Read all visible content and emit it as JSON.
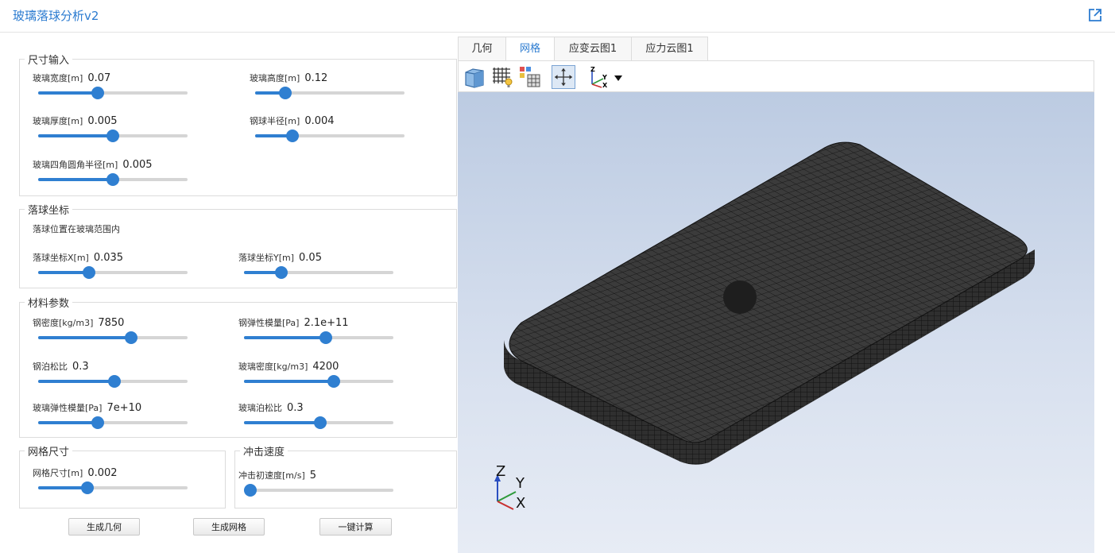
{
  "app": {
    "title": "玻璃落球分析v2",
    "popout_icon": "external-link-icon",
    "accent": "#2b7bd0"
  },
  "size_input": {
    "legend": "尺寸输入",
    "glass_width": {
      "label": "玻璃宽度[m]",
      "value": "0.07",
      "level": 0.4
    },
    "glass_height": {
      "label": "玻璃高度[m]",
      "value": "0.12",
      "level": 0.2
    },
    "glass_thickness": {
      "label": "玻璃厚度[m]",
      "value": "0.005",
      "level": 0.5
    },
    "ball_radius": {
      "label": "钢球半径[m]",
      "value": "0.004",
      "level": 0.25
    },
    "corner_radius": {
      "label": "玻璃四角圆角半径[m]",
      "value": "0.005",
      "level": 0.5
    }
  },
  "drop_coord": {
    "legend": "落球坐标",
    "note": "落球位置在玻璃范围内",
    "x": {
      "label": "落球坐标X[m]",
      "value": "0.035",
      "level": 0.34
    },
    "y": {
      "label": "落球坐标Y[m]",
      "value": "0.05",
      "level": 0.25
    }
  },
  "material": {
    "legend": "材料参数",
    "steel_density": {
      "label": "钢密度[kg/m3]",
      "value": "7850",
      "level": 0.62
    },
    "steel_modulus": {
      "label": "钢弹性模量[Pa]",
      "value": "2.1e+11",
      "level": 0.55
    },
    "steel_poisson": {
      "label": "钢泊松比",
      "value": "0.3",
      "level": 0.51
    },
    "glass_density": {
      "label": "玻璃密度[kg/m3]",
      "value": "4200",
      "level": 0.6
    },
    "glass_modulus": {
      "label": "玻璃弹性模量[Pa]",
      "value": "7e+10",
      "level": 0.4
    },
    "glass_poisson": {
      "label": "玻璃泊松比",
      "value": "0.3",
      "level": 0.51
    }
  },
  "mesh": {
    "legend": "网格尺寸",
    "size": {
      "label": "网格尺寸[m]",
      "value": "0.002",
      "level": 0.33
    }
  },
  "impact": {
    "legend": "冲击速度",
    "speed": {
      "label": "冲击初速度[m/s]",
      "value": "5",
      "level": 0.0
    }
  },
  "buttons": {
    "gen_geometry": "生成几何",
    "gen_mesh": "生成网格",
    "compute": "一键计算"
  },
  "viewer": {
    "tabs": [
      {
        "label": "几何",
        "active": false
      },
      {
        "label": "网格",
        "active": true
      },
      {
        "label": "应变云图1",
        "active": false
      },
      {
        "label": "应力云图1",
        "active": false
      }
    ],
    "toolbar_icons": [
      "cube-view-icon",
      "mesh-display-icon",
      "mesh-quality-icon",
      "fit-view-icon",
      "axis-orientation-icon",
      "dropdown-arrow-icon"
    ],
    "axes": {
      "z": "Z",
      "y": "Y",
      "x": "X"
    },
    "mesh_color": "#3b3b3b",
    "ball_color": "#1e1e1e"
  }
}
